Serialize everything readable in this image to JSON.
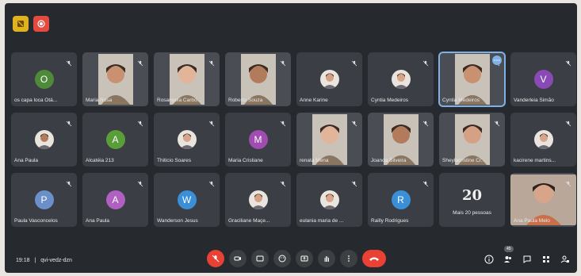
{
  "meeting": {
    "time": "19:18",
    "code": "qvi-vedz-dzn",
    "people_badge": "45"
  },
  "tiles": [
    {
      "name": "os capa loca Otá...",
      "type": "letter",
      "letter": "O",
      "color": "#4f8a3a"
    },
    {
      "name": "Maria Rosa",
      "type": "video"
    },
    {
      "name": "Rosangela Carbo...",
      "type": "video"
    },
    {
      "name": "Roberto Souza",
      "type": "video"
    },
    {
      "name": "Anne Karine",
      "type": "photo"
    },
    {
      "name": "Cyntia Medeiros",
      "type": "photo"
    },
    {
      "name": "Cyntia Medeiros",
      "type": "video",
      "active": true
    },
    {
      "name": "Vanderleia Simão",
      "type": "letter",
      "letter": "V",
      "color": "#8a4ab6"
    },
    {
      "name": "Ana Paula",
      "type": "photo"
    },
    {
      "name": "Alcatéia 213",
      "type": "letter",
      "letter": "A",
      "color": "#5a9e3a"
    },
    {
      "name": "Thiticio Soares",
      "type": "photo"
    },
    {
      "name": "Maria Cristiane",
      "type": "letter",
      "letter": "M",
      "color": "#a04cb0"
    },
    {
      "name": "renata Mena",
      "type": "video"
    },
    {
      "name": "Joanda Silveira",
      "type": "video"
    },
    {
      "name": "Sheylacristine Cr...",
      "type": "video"
    },
    {
      "name": "kacirene martins...",
      "type": "photo"
    },
    {
      "name": "Paula Vasconcelos",
      "type": "letter",
      "letter": "P",
      "color": "#6b8fc9"
    },
    {
      "name": "Ana Paula",
      "type": "letter",
      "letter": "A",
      "color": "#b060c0"
    },
    {
      "name": "Wanderson Jesus",
      "type": "letter",
      "letter": "W",
      "color": "#3a8fd6"
    },
    {
      "name": "Graciliane Maçe...",
      "type": "photo"
    },
    {
      "name": "eulania maria de ...",
      "type": "photo"
    },
    {
      "name": "Railly Rodrigues",
      "type": "letter",
      "letter": "R",
      "color": "#3a8fd6"
    },
    {
      "name": "Mais 20 pessoas",
      "type": "more",
      "count": "20"
    },
    {
      "name": "Ana Paula Melo",
      "type": "wide-video"
    }
  ]
}
